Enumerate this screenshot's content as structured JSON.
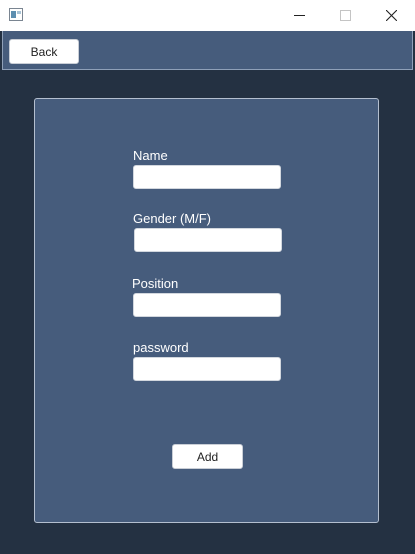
{
  "window": {
    "title": "",
    "controls": [
      "minimize-icon",
      "maximize-icon",
      "close-icon"
    ]
  },
  "toolbar": {
    "back_label": "Back"
  },
  "form": {
    "fields": [
      {
        "label": "Name",
        "value": ""
      },
      {
        "label": "Gender (M/F)",
        "value": ""
      },
      {
        "label": "Position",
        "value": ""
      },
      {
        "label": "password",
        "value": ""
      }
    ],
    "add_label": "Add"
  },
  "colors": {
    "background": "#243142",
    "panel": "#465c7c",
    "field": "#ffffff",
    "text": "#ffffff"
  }
}
